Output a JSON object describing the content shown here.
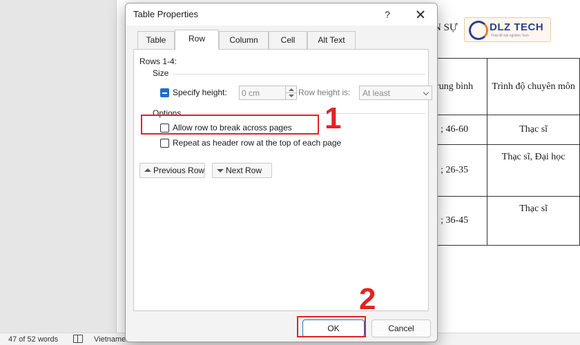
{
  "document": {
    "heading_fragment": "N SỰ",
    "logo_text": "DLZ TECH",
    "logo_subtext": "Thật dễ trải nghiệm Tech",
    "table_rows": [
      {
        "col1": "rung bình",
        "col2": "Trình độ chuyên môn"
      },
      {
        "col1": "; 46-60",
        "col2": "Thạc sĩ"
      },
      {
        "col1": "; 26-35",
        "col2": "Thạc sĩ, Đại học"
      },
      {
        "col1": "; 36-45",
        "col2": "Thạc sĩ"
      }
    ]
  },
  "status_bar": {
    "word_count": "47 of 52 words",
    "language": "Vietnamese"
  },
  "dialog": {
    "title": "Table Properties",
    "help_label": "?",
    "tabs": [
      {
        "label": "Table",
        "active": false
      },
      {
        "label": "Row",
        "active": true
      },
      {
        "label": "Column",
        "active": false
      },
      {
        "label": "Cell",
        "active": false
      },
      {
        "label": "Alt Text",
        "active": false
      }
    ],
    "rows_label": "Rows 1-4:",
    "size_group": "Size",
    "specify_height_label": "Specify height:",
    "specify_height_checked": true,
    "height_value": "0 cm",
    "row_height_is_label": "Row height is:",
    "row_height_mode": "At least",
    "options_group": "Options",
    "allow_break_label": "Allow row to break across pages",
    "allow_break_checked": false,
    "repeat_header_label": "Repeat as header row at the top of each page",
    "repeat_header_checked": false,
    "previous_row_label": "Previous Row",
    "next_row_label": "Next Row",
    "ok_label": "OK",
    "cancel_label": "Cancel"
  },
  "annotations": {
    "step1": "1",
    "step2": "2",
    "highlight_color": "#e02424"
  },
  "colors": {
    "accent": "#1d6fc9",
    "dialog_bg": "#f3f3f3"
  }
}
